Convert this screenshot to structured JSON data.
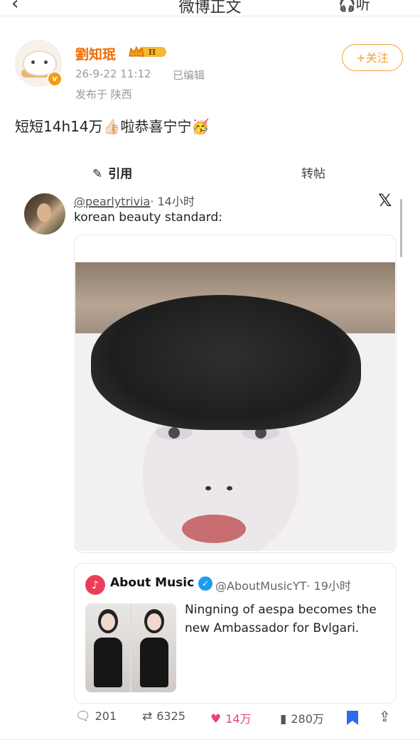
{
  "header": {
    "back_icon": "chevron-left-icon",
    "title": "微博正文",
    "listen_label": "听",
    "more_icon": "more-dots-icon"
  },
  "author": {
    "name": "劉知珉",
    "vip_level": "II",
    "timestamp": "26-9-22 11:12",
    "edited": "已编辑",
    "location": "发布于 陕西",
    "follow_label": "+关注"
  },
  "post": {
    "text": "短短14h14万",
    "text_suffix": "啦恭喜宁宁",
    "emoji_1": "👍🏻",
    "emoji_2": "🥳"
  },
  "tabs": {
    "quote_label": "引用",
    "repost_label": "转帖"
  },
  "tweet": {
    "handle": "@pearlytrivia",
    "time": "· 14小时",
    "text": "korean beauty standard:",
    "x_logo": "𝕏"
  },
  "quoted_tweet": {
    "name": "About Music",
    "handle": "@AboutMusicYT",
    "time": "· 19小时",
    "text": "Ningning of aespa becomes the new Ambassador for Bvlgari."
  },
  "actions": {
    "replies": "201",
    "retweets": "6325",
    "likes": "14万",
    "views": "280万"
  },
  "colors": {
    "accent_orange": "#f59e3c",
    "username_orange": "#ef6c00",
    "like_pink": "#e8457a",
    "bookmark_blue": "#2a6cf0"
  }
}
